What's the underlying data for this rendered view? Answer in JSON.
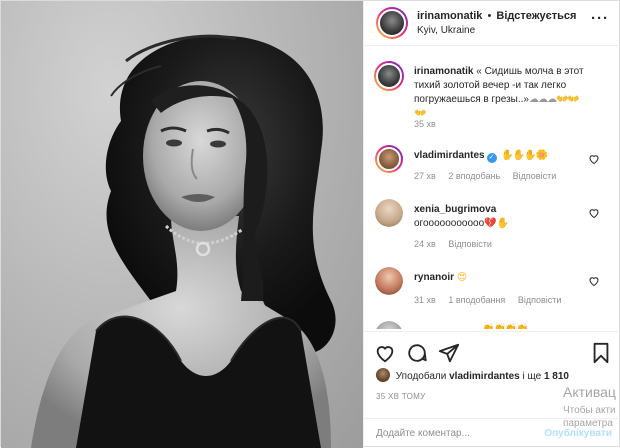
{
  "header": {
    "username": "irinamonatik",
    "separator": "•",
    "follow_status": "Відстежується",
    "location": "Kyiv, Ukraine",
    "more_icon": "more-horizontal-icon"
  },
  "caption": {
    "username": "irinamonatik",
    "text": "« Сидишь молча в этот тихий золотой вечер -и так легко погружаешься в грезы..»",
    "emojis_gray": "☁☁☁",
    "emojis_hands": "👐👐👐",
    "time": "35 хв"
  },
  "comments": [
    {
      "username": "vladimirdantes",
      "verified": true,
      "text": "",
      "emojis": "✋✋✋🌼",
      "time": "27 хв",
      "likes": "2 вподобань",
      "reply": "Відповісти"
    },
    {
      "username": "xenia_bugrimova",
      "text": "огооооооооооо",
      "emojis": "💔✋",
      "time": "24 хв",
      "reply": "Відповісти"
    },
    {
      "username": "rynanoir",
      "text": "",
      "emojis": "😍",
      "time": "31 хв",
      "likes": "1 вподобання",
      "reply": "Відповісти"
    },
    {
      "username": "",
      "emojis": "👏👏👏👏"
    }
  ],
  "actions": {
    "like_icon": "heart-icon",
    "comment_icon": "comment-icon",
    "share_icon": "paper-plane-icon",
    "save_icon": "bookmark-icon"
  },
  "likes": {
    "prefix": "Уподобали",
    "user": "vladimirdantes",
    "middle": "і ще",
    "count": "1 810"
  },
  "posted_time": "35 ХВ ТОМУ",
  "add_comment": {
    "placeholder": "Додайте коментар...",
    "publish_label": "Опублікувати"
  },
  "watermark": {
    "title": "Активац",
    "line1": "Чтобы акти",
    "line2": "параметра"
  },
  "colors": {
    "accent": "#3897f0",
    "publish_disabled": "#b2dffc",
    "meta_text": "#8e8e8e"
  }
}
